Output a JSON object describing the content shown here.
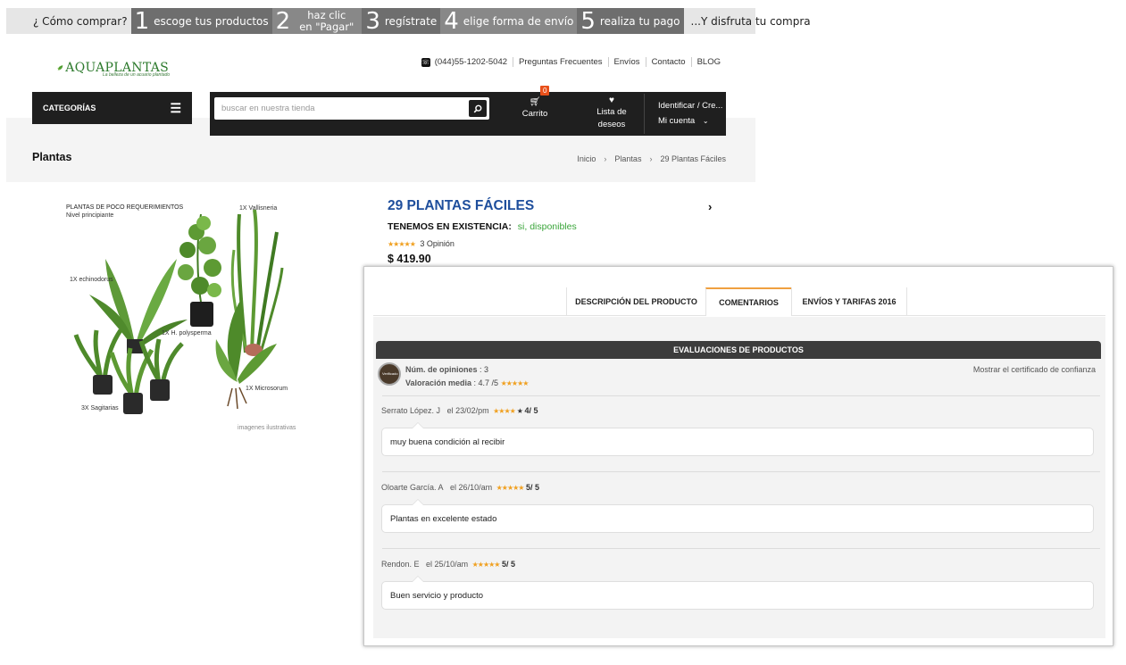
{
  "steps": {
    "intro": "¿ Cómo comprar?",
    "items": [
      {
        "num": "1",
        "label": "escoge tus productos"
      },
      {
        "num": "2",
        "label_line1": "haz clic",
        "label_line2": "en \"Pagar\""
      },
      {
        "num": "3",
        "label": "regístrate"
      },
      {
        "num": "4",
        "label": "elige forma de envío"
      },
      {
        "num": "5",
        "label": "realiza tu pago"
      }
    ],
    "outro": "...Y disfruta tu compra"
  },
  "header": {
    "logo_text": "AQUAPLANTAS",
    "logo_tagline": "La belleza de un acuario plantado",
    "phone": "(044)55-1202-5042",
    "links": [
      "Preguntas Frecuentes",
      "Envíos",
      "Contacto",
      "BLOG"
    ]
  },
  "nav": {
    "categories_label": "CATEGORÍAS",
    "search_placeholder": "buscar en nuestra tienda",
    "cart_label": "Carrito",
    "cart_count": "0",
    "wishlist_line1": "Lista de",
    "wishlist_line2": "deseos",
    "account_line1": "Identificar / Cre...",
    "account_line2": "Mi cuenta"
  },
  "page": {
    "title": "Plantas",
    "breadcrumbs": [
      "Inicio",
      "Plantas",
      "29 Plantas Fáciles"
    ]
  },
  "product": {
    "image_labels": {
      "heading": "PLANTAS DE POCO REQUERIMIENTOS",
      "subheading": "Nivel principiante",
      "vallisneria": "1X Vallisneria",
      "echinodorus": "1X echinodorus",
      "polysperma": "1X H. polysperma",
      "microsorum": "1X Microsorum",
      "sagitarias": "3X Sagitarias",
      "note": "imagenes ilustrativas"
    },
    "name": "29 PLANTAS FÁCILES",
    "stock_label": "TENEMOS EN EXISTENCIA:",
    "stock_value": "si, disponibles",
    "rating_stars": "★★★★★",
    "opinions": "3 Opinión",
    "price": "$ 419.90"
  },
  "tabs": [
    {
      "label": "DESCRIPCIÓN DEL PRODUCTO",
      "active": false
    },
    {
      "label": "COMENTARIOS",
      "active": true
    },
    {
      "label": "ENVÍOS Y TARIFAS 2016",
      "active": false
    }
  ],
  "reviews": {
    "header": "EVALUACIONES DE PRODUCTOS",
    "seal_text": "Verificado",
    "num_label": "Núm. de opiniones",
    "num_value": " : 3",
    "avg_label": "Valoración media",
    "avg_value": " : 4.7 /5 ",
    "avg_stars": "★★★★★",
    "trust_link": "Mostrar el certificado de confianza",
    "items": [
      {
        "author": "Serrato López. J",
        "date": "el 23/02/pm",
        "stars": "★★★★",
        "empty_stars": "★",
        "score": "4/ 5",
        "text": "muy buena condición al recibir"
      },
      {
        "author": "Oloarte García. A",
        "date": "el 26/10/am",
        "stars": "★★★★★",
        "empty_stars": "",
        "score": "5/ 5",
        "text": "Plantas en excelente estado"
      },
      {
        "author": "Rendon. E",
        "date": "el 25/10/am",
        "stars": "★★★★★",
        "empty_stars": "",
        "score": "5/ 5",
        "text": "Buen servicio y producto"
      }
    ]
  },
  "colors": {
    "accent_blue": "#1e4e9c",
    "stock_green": "#3aa53a",
    "star_orange": "#f0a020",
    "badge_orange": "#e8501a",
    "dark_bar": "#1f1f1f"
  }
}
